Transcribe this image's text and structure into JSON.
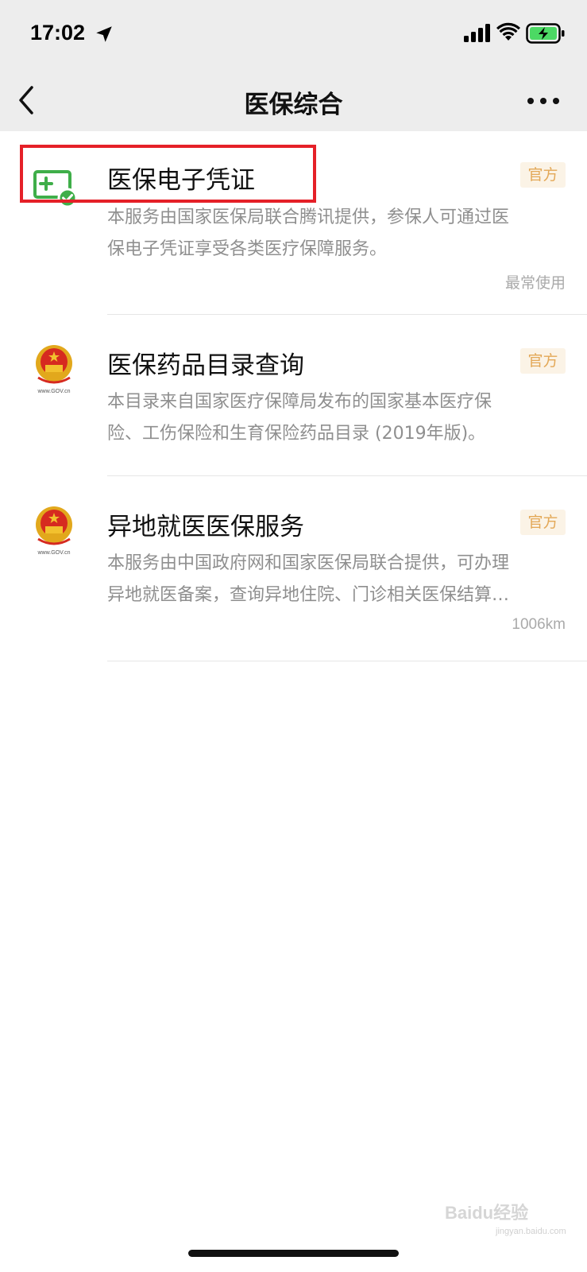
{
  "status_bar": {
    "time": "17:02"
  },
  "nav": {
    "title": "医保综合",
    "back_icon": "chevron-left-icon",
    "more_icon": "more-dots-icon"
  },
  "items": [
    {
      "title": "医保电子凭证",
      "badge": "官方",
      "desc_line1": "本服务由国家医保局联合腾讯提供，参保人可通过医",
      "desc_line2": "保电子凭证享受各类医疗保障服务。",
      "meta": "最常使用",
      "icon": "medical-card-icon"
    },
    {
      "title": "医保药品目录查询",
      "badge": "官方",
      "desc_line1": "本目录来自国家医疗保障局发布的国家基本医疗保",
      "desc_line2": "险、工伤保险和生育保险药品目录 (2019年版)。",
      "icon": "national-emblem-icon",
      "icon_caption": "www.GOV.cn"
    },
    {
      "title": "异地就医医保服务",
      "badge": "官方",
      "desc_line1": "本服务由中国政府网和国家医保局联合提供，可办理",
      "desc_line2": "异地就医备案，查询异地住院、门诊相关医保结算…",
      "meta": "1006km",
      "icon": "national-emblem-icon",
      "icon_caption": "www.GOV.cn"
    }
  ],
  "watermark": {
    "brand": "Baidu经验",
    "site": "jingyan.baidu.com"
  },
  "colors": {
    "header_bg": "#ededed",
    "badge_text": "#e3a857",
    "badge_bg": "#fbf3e6",
    "highlight": "#e52028",
    "icon_green": "#3fae49"
  }
}
